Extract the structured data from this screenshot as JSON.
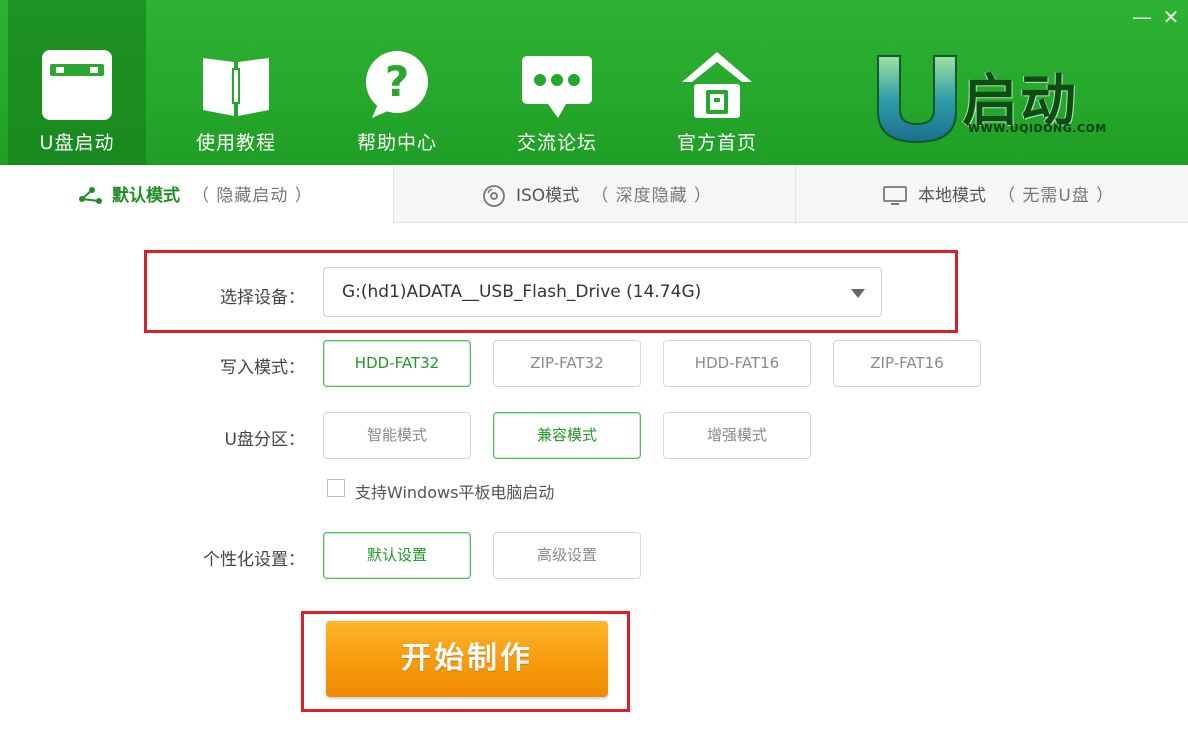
{
  "window": {
    "minimize_glyph": "—",
    "close_glyph": "✕"
  },
  "nav": [
    {
      "label": "U盘启动",
      "icon": "usb-drive-icon",
      "active": true
    },
    {
      "label": "使用教程",
      "icon": "book-icon",
      "active": false
    },
    {
      "label": "帮助中心",
      "icon": "question-bubble-icon",
      "active": false
    },
    {
      "label": "交流论坛",
      "icon": "chat-bubble-icon",
      "active": false
    },
    {
      "label": "官方首页",
      "icon": "home-icon",
      "active": false
    }
  ],
  "logo": {
    "letter": "U",
    "text": "启动",
    "url": "WWW.UQIDONG.COM"
  },
  "tabs": [
    {
      "title": "默认模式",
      "sub": "（ 隐藏启动 ）",
      "icon": "share-nodes-icon",
      "active": true
    },
    {
      "title": "ISO模式",
      "sub": "（ 深度隐藏 ）",
      "icon": "disc-icon",
      "active": false
    },
    {
      "title": "本地模式",
      "sub": "（ 无需U盘 ）",
      "icon": "monitor-icon",
      "active": false
    }
  ],
  "form": {
    "device_label": "选择设备：",
    "device_value": "G:(hd1)ADATA__USB_Flash_Drive (14.74G)",
    "write_mode_label": "写入模式：",
    "write_modes": [
      {
        "label": "HDD-FAT32",
        "selected": true
      },
      {
        "label": "ZIP-FAT32",
        "selected": false
      },
      {
        "label": "HDD-FAT16",
        "selected": false
      },
      {
        "label": "ZIP-FAT16",
        "selected": false
      }
    ],
    "partition_label": "U盘分区：",
    "partition_modes": [
      {
        "label": "智能模式",
        "selected": false
      },
      {
        "label": "兼容模式",
        "selected": true
      },
      {
        "label": "增强模式",
        "selected": false
      }
    ],
    "tablet_checkbox_label": "支持Windows平板电脑启动",
    "tablet_checked": false,
    "personalize_label": "个性化设置：",
    "personalize_options": [
      {
        "label": "默认设置",
        "selected": true
      },
      {
        "label": "高级设置",
        "selected": false
      }
    ],
    "start_button": "开始制作"
  },
  "colors": {
    "header_green": "#25a82b",
    "accent_green": "#1f9a27",
    "highlight_red": "#d9212b",
    "start_orange": "#f79a0c"
  }
}
